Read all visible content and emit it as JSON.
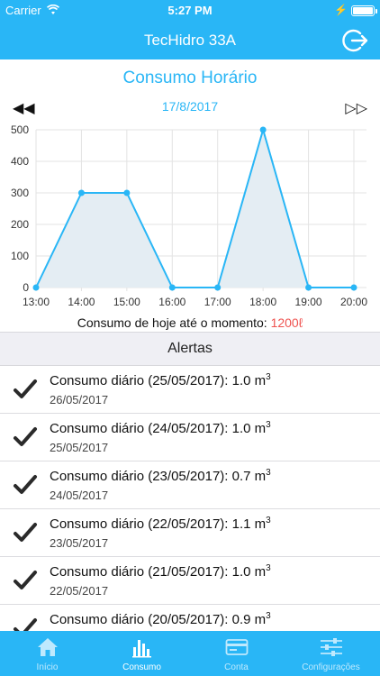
{
  "status": {
    "carrier": "Carrier",
    "time": "5:27 PM"
  },
  "nav": {
    "title": "TecHidro 33A",
    "logout_icon": "logout-icon"
  },
  "section": {
    "title": "Consumo Horário",
    "date": "17/8/2017",
    "prev_label": "◀◀",
    "next_label": "▷▷"
  },
  "chart_data": {
    "type": "area",
    "categories": [
      "13:00",
      "14:00",
      "15:00",
      "16:00",
      "17:00",
      "18:00",
      "19:00",
      "20:00"
    ],
    "values": [
      0,
      300,
      300,
      0,
      0,
      500,
      0,
      0
    ],
    "yticks": [
      "0",
      "100",
      "200",
      "300",
      "400",
      "500"
    ],
    "ylim": [
      0,
      500
    ],
    "grid": true,
    "line_color": "#29b6f6",
    "fill_color": "#e4edf3"
  },
  "today": {
    "label": "Consumo de hoje até o momento: ",
    "value": "1200ℓ"
  },
  "alerts": {
    "header": "Alertas",
    "items": [
      {
        "text": "Consumo diário (25/05/2017): 1.0 m",
        "sup": "3",
        "date": "26/05/2017"
      },
      {
        "text": "Consumo diário (24/05/2017): 1.0 m",
        "sup": "3",
        "date": "25/05/2017"
      },
      {
        "text": "Consumo diário (23/05/2017): 0.7 m",
        "sup": "3",
        "date": "24/05/2017"
      },
      {
        "text": "Consumo diário (22/05/2017): 1.1 m",
        "sup": "3",
        "date": "23/05/2017"
      },
      {
        "text": "Consumo diário (21/05/2017): 1.0 m",
        "sup": "3",
        "date": "22/05/2017"
      },
      {
        "text": "Consumo diário (20/05/2017): 0.9 m",
        "sup": "3",
        "date": ""
      }
    ]
  },
  "tabs": [
    {
      "label": "Início",
      "icon": "home-icon",
      "active": false
    },
    {
      "label": "Consumo",
      "icon": "bar-chart-icon",
      "active": true
    },
    {
      "label": "Conta",
      "icon": "card-icon",
      "active": false
    },
    {
      "label": "Configurações",
      "icon": "sliders-icon",
      "active": false
    }
  ],
  "colors": {
    "accent": "#29b6f6",
    "alert_value": "#ef5350"
  }
}
